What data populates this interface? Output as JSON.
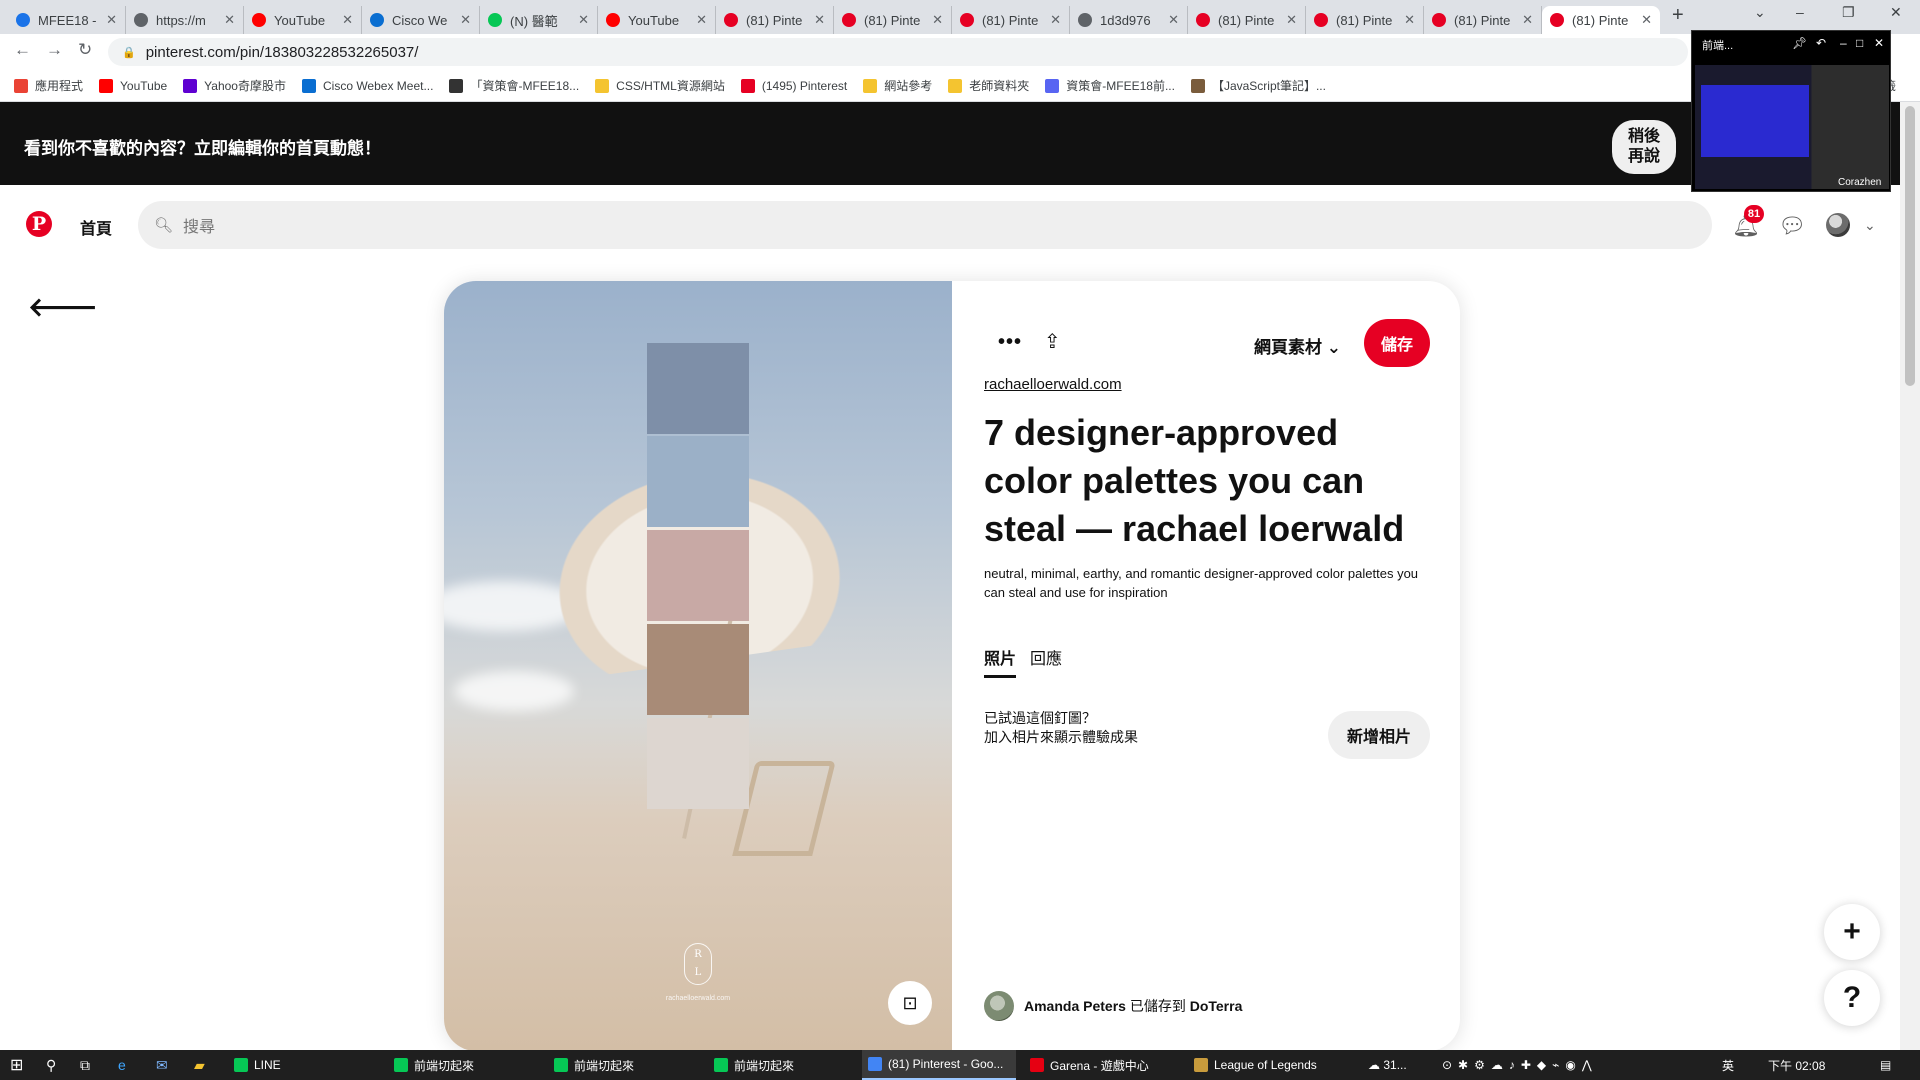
{
  "browser": {
    "tabs": [
      {
        "title": "MFEE18 -",
        "icon": "google-drive-icon",
        "color": "#1a73e8"
      },
      {
        "title": "https://m",
        "icon": "globe-icon",
        "color": "#5f6368"
      },
      {
        "title": "YouTube",
        "icon": "youtube-icon",
        "color": "#ff0000"
      },
      {
        "title": "Cisco We",
        "icon": "webex-icon",
        "color": "#0a6ed1"
      },
      {
        "title": "(N) 醫範",
        "icon": "line-icon",
        "color": "#06c755"
      },
      {
        "title": "YouTube",
        "icon": "youtube-icon",
        "color": "#ff0000"
      },
      {
        "title": "(81) Pinte",
        "icon": "pinterest-icon",
        "color": "#e60023"
      },
      {
        "title": "(81) Pinte",
        "icon": "pinterest-icon",
        "color": "#e60023"
      },
      {
        "title": "(81) Pinte",
        "icon": "pinterest-icon",
        "color": "#e60023"
      },
      {
        "title": "1d3d976",
        "icon": "globe-icon",
        "color": "#5f6368"
      },
      {
        "title": "(81) Pinte",
        "icon": "pinterest-icon",
        "color": "#e60023"
      },
      {
        "title": "(81) Pinte",
        "icon": "pinterest-icon",
        "color": "#e60023"
      },
      {
        "title": "(81) Pinte",
        "icon": "pinterest-icon",
        "color": "#e60023"
      },
      {
        "title": "(81) Pinte",
        "icon": "pinterest-icon",
        "color": "#e60023"
      }
    ],
    "url": "pinterest.com/pin/183803228532265037/",
    "bookmarks": [
      {
        "label": "應用程式",
        "icon": "apps-grid-icon",
        "color": "#ea4335"
      },
      {
        "label": "YouTube",
        "icon": "youtube-icon",
        "color": "#ff0000"
      },
      {
        "label": "Yahoo奇摩股市",
        "icon": "yahoo-icon",
        "color": "#5f01d1"
      },
      {
        "label": "Cisco Webex Meet...",
        "icon": "webex-icon",
        "color": "#0a6ed1"
      },
      {
        "label": "「資策會-MFEE18...",
        "icon": "person-card-icon",
        "color": "#333333"
      },
      {
        "label": "CSS/HTML資源網站",
        "icon": "folder-icon",
        "color": "#f4c430"
      },
      {
        "label": "(1495) Pinterest",
        "icon": "pinterest-icon",
        "color": "#e60023"
      },
      {
        "label": "網站參考",
        "icon": "folder-icon",
        "color": "#f4c430"
      },
      {
        "label": "老師資料夾",
        "icon": "folder-icon",
        "color": "#f4c430"
      },
      {
        "label": "資策會-MFEE18前...",
        "icon": "discord-icon",
        "color": "#5865f2"
      },
      {
        "label": "【JavaScript筆記】...",
        "icon": "blog-icon",
        "color": "#7a5c3c"
      }
    ],
    "bookmarks_more": "書籤"
  },
  "banner": {
    "message": "看到你不喜歡的內容？立即編輯你的首頁動態！",
    "later_label": "稍後\n再說"
  },
  "header": {
    "home_label": "首頁",
    "search_placeholder": "搜尋",
    "notification_count": "81"
  },
  "pin": {
    "swatches": [
      "#7e8fa8",
      "#9bb0c7",
      "#c8a9a5",
      "#a88b77",
      "#ddd6d0"
    ],
    "logo_letters": "R\nL",
    "image_url_text": "rachaelloerwald.com",
    "board_label": "網頁素材",
    "save_label": "儲存",
    "source": "rachaelloerwald.com",
    "title": "7 designer-approved color palettes you can steal — rachael loerwald",
    "description": "neutral, minimal, earthy, and romantic designer-approved color palettes you can steal and use for inspiration",
    "tabs": {
      "photos": "照片",
      "comments": "回應"
    },
    "tried_line1": "已試過這個釘圖？",
    "tried_line2": "加入相片來顯示體驗成果",
    "add_photo_label": "新增相片",
    "saver_name": "Amanda Peters",
    "saver_action": "已儲存到",
    "saver_board": "DoTerra"
  },
  "pip": {
    "title": "前端...",
    "name": "Corazhen"
  },
  "taskbar": {
    "items": [
      {
        "label": "LINE",
        "icon": "line-icon",
        "color": "#06c755"
      },
      {
        "label": "前端切起來",
        "icon": "phone-icon",
        "color": "#06c755"
      },
      {
        "label": "前端切起來",
        "icon": "phone-icon",
        "color": "#06c755"
      },
      {
        "label": "前端切起來",
        "icon": "line-icon",
        "color": "#06c755"
      },
      {
        "label": "(81) Pinterest - Goo...",
        "icon": "chrome-icon",
        "color": "#4285f4"
      },
      {
        "label": "Garena - 遊戲中心",
        "icon": "garena-icon",
        "color": "#e60012"
      },
      {
        "label": "League of Legends",
        "icon": "lol-icon",
        "color": "#c89b3c"
      }
    ],
    "weather": "31...",
    "ime": "英",
    "clock": "下午 02:08"
  }
}
